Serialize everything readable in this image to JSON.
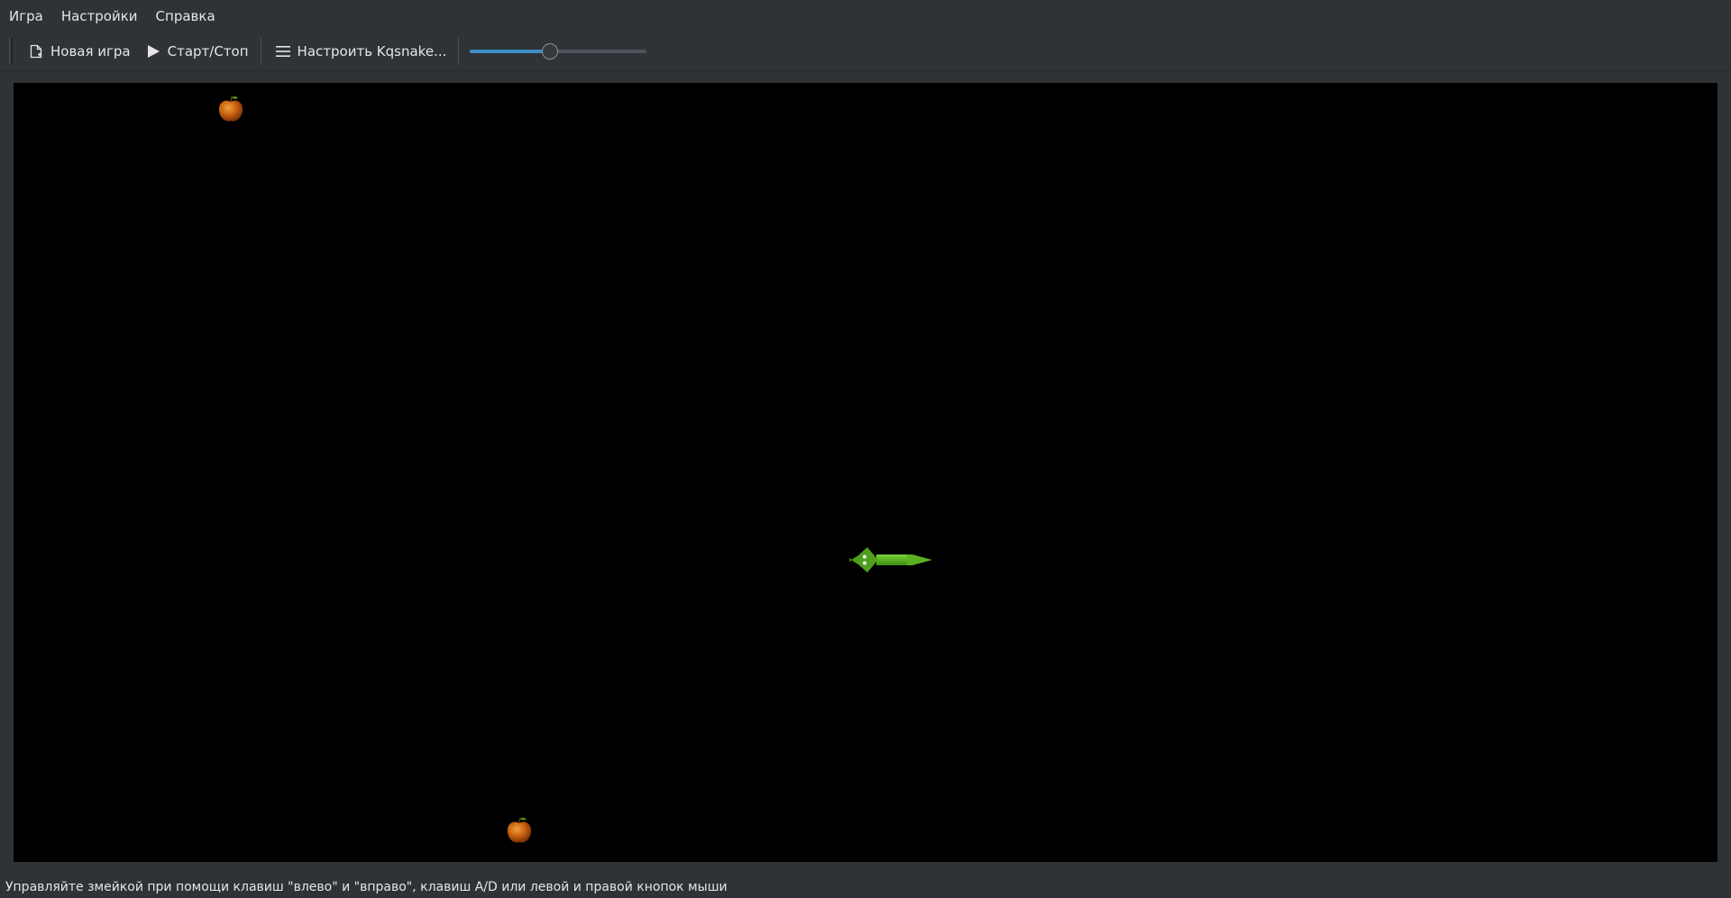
{
  "menubar": {
    "items": [
      {
        "label": "Игра"
      },
      {
        "label": "Настройки"
      },
      {
        "label": "Справка"
      }
    ]
  },
  "toolbar": {
    "new_game_label": "Новая игра",
    "new_game_icon": "new-document-icon",
    "start_stop_label": "Старт/Стоп",
    "start_stop_icon": "play-icon",
    "configure_label": "Настроить Kqsnake...",
    "configure_icon": "hamburger-menu-icon",
    "speed_slider_value": 0.45
  },
  "game": {
    "background_color": "#000000",
    "apple_color": "#d2691e",
    "snake_color": "#4caf1a"
  },
  "statusbar": {
    "text": "Управляйте змейкой при помощи клавиш \"влево\" и \"вправо\", клавиш A/D или левой и правой кнопок мыши"
  }
}
